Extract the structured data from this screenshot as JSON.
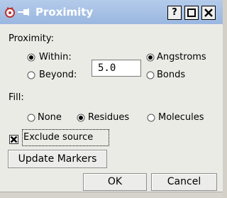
{
  "window": {
    "title": "Proximity",
    "controls": {
      "help": "?",
      "maximize": "□",
      "close": "✕"
    }
  },
  "proximity": {
    "section_label": "Proximity:",
    "within_label": "Within:",
    "beyond_label": "Beyond:",
    "distance_value": "5.0",
    "angstroms_label": "Angstroms",
    "bonds_label": "Bonds",
    "selected_mode": "Within",
    "selected_unit": "Angstroms"
  },
  "fill": {
    "section_label": "Fill:",
    "options": [
      "None",
      "Residues",
      "Molecules"
    ],
    "selected": "Residues"
  },
  "exclude_source": {
    "label": "Exclude source",
    "checked": true
  },
  "buttons": {
    "update_markers": "Update Markers",
    "ok": "OK",
    "cancel": "Cancel"
  },
  "colors": {
    "titlebar": "#9ab7e0",
    "dialog_bg": "#ebebe6",
    "title_text": "#ffffff"
  }
}
